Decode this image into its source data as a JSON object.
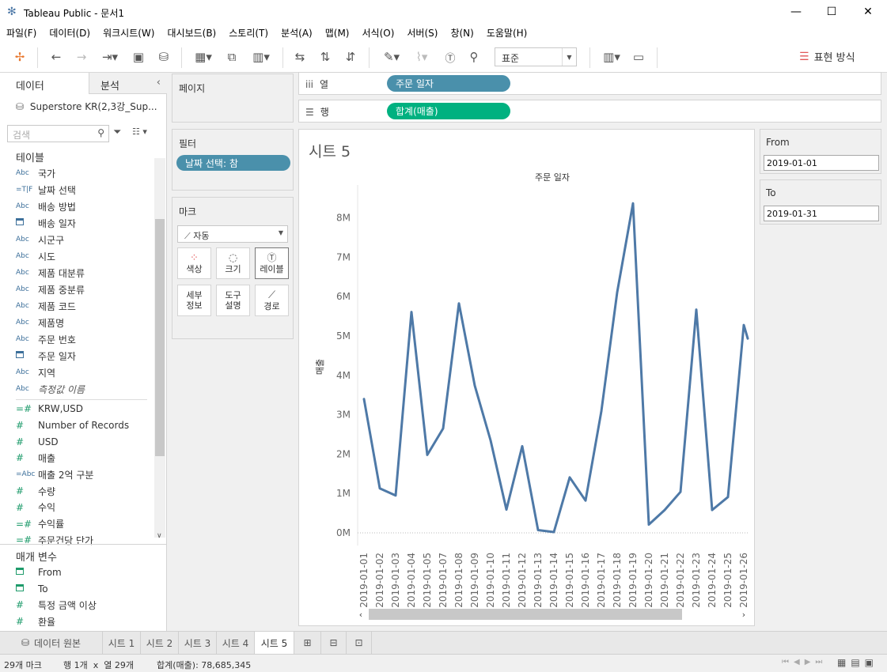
{
  "window": {
    "title": "Tableau Public - 문서1"
  },
  "menu": [
    "파일(F)",
    "데이터(D)",
    "워크시트(W)",
    "대시보드(B)",
    "스토리(T)",
    "분석(A)",
    "맵(M)",
    "서식(O)",
    "서버(S)",
    "창(N)",
    "도움말(H)"
  ],
  "toolbar": {
    "fit": "표준",
    "show_me": "표현 방식"
  },
  "leftpanel": {
    "tab_data": "데이터",
    "tab_analysis": "분석",
    "datasource": "Superstore KR(2,3강_Sup...",
    "search_placeholder": "검색",
    "tables_header": "테이블",
    "dimensions": [
      {
        "icon": "Abc",
        "label": "국가"
      },
      {
        "icon": "=T|F",
        "label": "날짜 선택"
      },
      {
        "icon": "Abc",
        "label": "배송 방법"
      },
      {
        "icon": "calendar",
        "label": "배송 일자"
      },
      {
        "icon": "Abc",
        "label": "시군구"
      },
      {
        "icon": "Abc",
        "label": "시도"
      },
      {
        "icon": "Abc",
        "label": "제품 대분류"
      },
      {
        "icon": "Abc",
        "label": "제품 중분류"
      },
      {
        "icon": "Abc",
        "label": "제품 코드"
      },
      {
        "icon": "Abc",
        "label": "제품명"
      },
      {
        "icon": "Abc",
        "label": "주문 번호"
      },
      {
        "icon": "calendar",
        "label": "주문 일자"
      },
      {
        "icon": "Abc",
        "label": "지역"
      },
      {
        "icon": "Abc",
        "label": "측정값 이름"
      }
    ],
    "measures": [
      {
        "icon": "=#",
        "label": "KRW,USD"
      },
      {
        "icon": "#",
        "label": "Number of Records"
      },
      {
        "icon": "#",
        "label": "USD"
      },
      {
        "icon": "#",
        "label": "매출"
      },
      {
        "icon": "=Abc",
        "label": "매출 2억 구분"
      },
      {
        "icon": "#",
        "label": "수량"
      },
      {
        "icon": "#",
        "label": "수익"
      },
      {
        "icon": "=#",
        "label": "수익률"
      },
      {
        "icon": "=#",
        "label": "주문건당 단가"
      }
    ],
    "params_header": "매개 변수",
    "params": [
      {
        "icon": "calendar",
        "label": "From"
      },
      {
        "icon": "calendar",
        "label": "To"
      },
      {
        "icon": "#",
        "label": "특정 금액 이상"
      },
      {
        "icon": "#",
        "label": "환율"
      }
    ]
  },
  "cards": {
    "pages": "페이지",
    "filters": "필터",
    "filter_pill": "날짜 선택: 참",
    "marks": "마크",
    "marks_type": "자동",
    "mark_buttons": [
      "색상",
      "크기",
      "레이블",
      "세부\n정보",
      "도구\n설명",
      "경로"
    ]
  },
  "shelves": {
    "columns_label": "열",
    "columns_pill": "주문 일자",
    "rows_label": "행",
    "rows_pill": "합계(매출)"
  },
  "view": {
    "sheet_title": "시트 5"
  },
  "colors": {
    "line": "#4e79a7",
    "col_pill": "#4a90ab",
    "row_pill": "#00b180"
  },
  "chart_data": {
    "type": "line",
    "title": "주문 일자",
    "ylabel": "매출",
    "ylim": [
      0,
      9000000
    ],
    "yticks": [
      "0M",
      "1M",
      "2M",
      "3M",
      "4M",
      "5M",
      "6M",
      "7M",
      "8M"
    ],
    "categories": [
      "2019-01-01",
      "2019-01-02",
      "2019-01-03",
      "2019-01-04",
      "2019-01-05",
      "2019-01-07",
      "2019-01-08",
      "2019-01-09",
      "2019-01-10",
      "2019-01-11",
      "2019-01-12",
      "2019-01-13",
      "2019-01-14",
      "2019-01-15",
      "2019-01-16",
      "2019-01-17",
      "2019-01-18",
      "2019-01-19",
      "2019-01-20",
      "2019-01-21",
      "2019-01-22",
      "2019-01-23",
      "2019-01-24",
      "2019-01-25",
      "2019-01-26"
    ],
    "values": [
      3400000,
      1130000,
      950000,
      5610000,
      1980000,
      2650000,
      5830000,
      3740000,
      2350000,
      590000,
      2200000,
      70000,
      20000,
      1410000,
      820000,
      3090000,
      6110000,
      8370000,
      210000,
      580000,
      1040000,
      5670000,
      580000,
      910000,
      5280000
    ],
    "partial_last": 3900000
  },
  "param_cards": {
    "from_label": "From",
    "from_value": "2019-01-01",
    "to_label": "To",
    "to_value": "2019-01-31"
  },
  "tabs": {
    "datasource": "데이터 원본",
    "sheets": [
      "시트 1",
      "시트 2",
      "시트 3",
      "시트 4",
      "시트 5"
    ]
  },
  "status": {
    "marks": "29개 마크",
    "rows_cols": "행 1개  x  열 29개",
    "sum": "합계(매출): 78,685,345"
  }
}
